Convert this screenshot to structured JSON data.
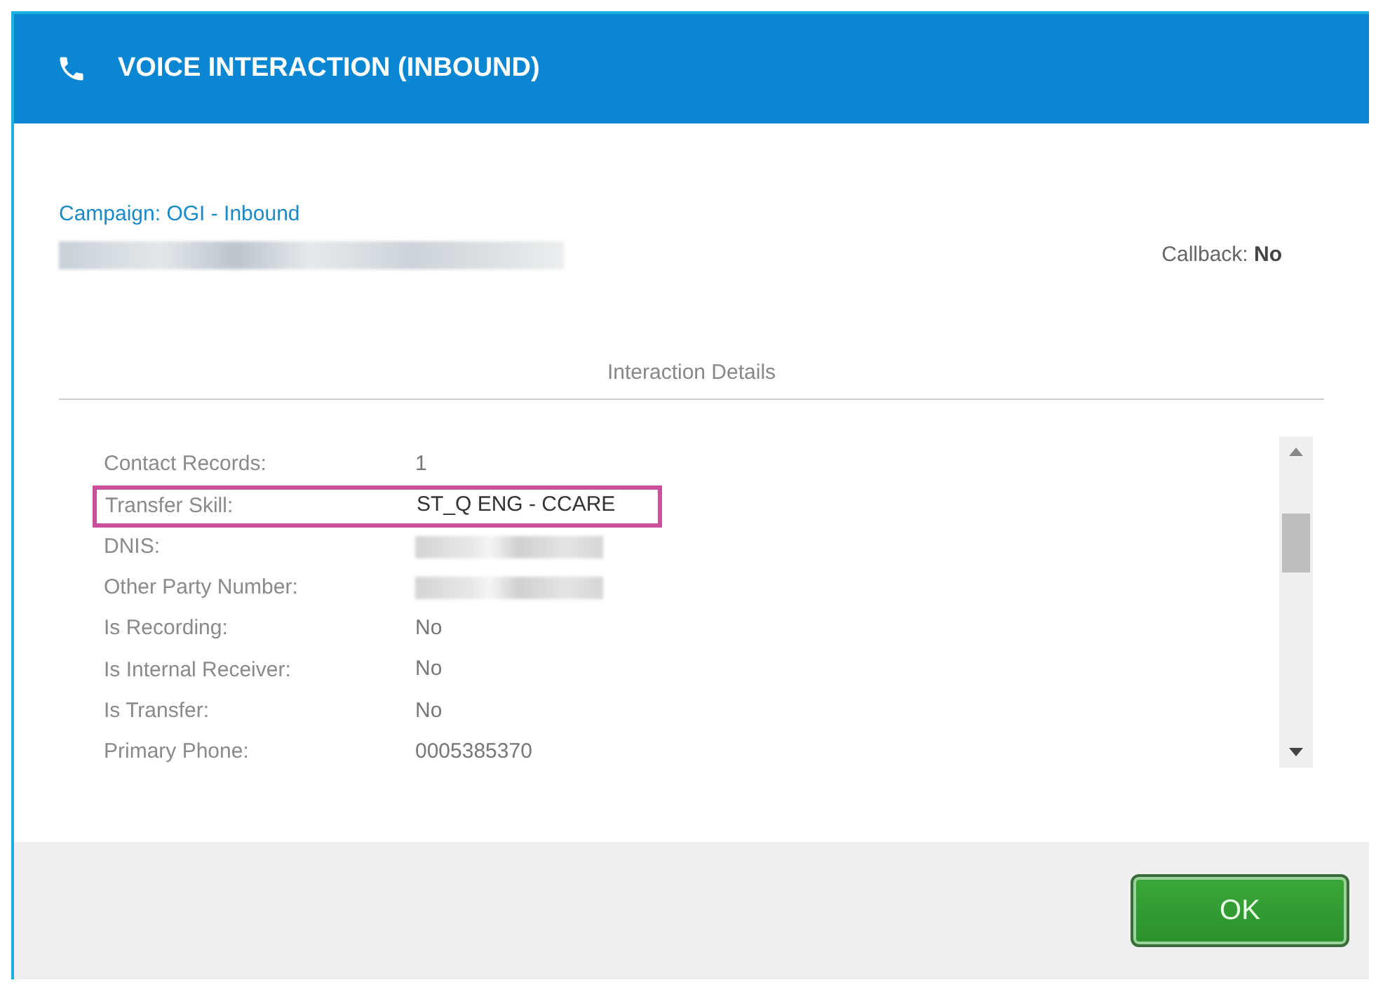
{
  "window": {
    "title": "VOICE INTERACTION (INBOUND)"
  },
  "campaign": "Campaign: OGI - Inbound",
  "callback": {
    "label": "Callback:",
    "value": "No"
  },
  "section_title": "Interaction Details",
  "details": [
    {
      "label": "Contact Records:",
      "kind": "text",
      "value": "1",
      "highlighted": false
    },
    {
      "label": "Transfer Skill:",
      "kind": "text",
      "value": "ST_Q ENG - CCARE",
      "highlighted": true
    },
    {
      "label": "DNIS:",
      "kind": "redacted",
      "highlighted": false
    },
    {
      "label": "Other Party Number:",
      "kind": "redacted",
      "highlighted": false
    },
    {
      "label": "Is Recording:",
      "kind": "text",
      "value": "No",
      "highlighted": false
    },
    {
      "label": "Is Internal Receiver:",
      "kind": "text",
      "value": "No",
      "highlighted": false
    },
    {
      "label": "Is Transfer:",
      "kind": "text",
      "value": "No",
      "highlighted": false
    },
    {
      "label": "Primary Phone:",
      "kind": "text",
      "value": "0005385370",
      "highlighted": false
    }
  ],
  "buttons": [
    {
      "label": "OK"
    }
  ]
}
